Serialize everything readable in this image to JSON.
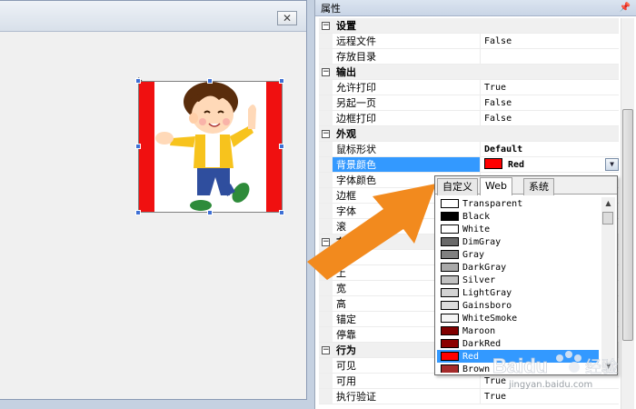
{
  "panel": {
    "title": "属性",
    "pin_icon": "pin-icon"
  },
  "designer": {
    "close_icon": "close-icon"
  },
  "properties": [
    {
      "type": "category",
      "name": "设置",
      "expander": "⊟"
    },
    {
      "type": "prop",
      "name": "远程文件",
      "value": "False"
    },
    {
      "type": "prop",
      "name": "存放目录",
      "value": ""
    },
    {
      "type": "category",
      "name": "输出",
      "expander": "⊟"
    },
    {
      "type": "prop",
      "name": "允许打印",
      "value": "True"
    },
    {
      "type": "prop",
      "name": "另起一页",
      "value": "False"
    },
    {
      "type": "prop",
      "name": "边框打印",
      "value": "False"
    },
    {
      "type": "category",
      "name": "外观",
      "expander": "⊟"
    },
    {
      "type": "prop",
      "name": "鼠标形状",
      "value": "Default"
    },
    {
      "type": "prop",
      "name": "背景颜色",
      "value": "Red"
    },
    {
      "type": "prop",
      "name": "字体颜色",
      "value": ""
    },
    {
      "type": "prop",
      "name": "边框",
      "value": ""
    },
    {
      "type": "prop",
      "name": "字体",
      "value": ""
    },
    {
      "type": "prop",
      "name": "滚",
      "value": ""
    },
    {
      "type": "category",
      "name": "布局",
      "expander": "⊟"
    },
    {
      "type": "prop",
      "name": "左",
      "value": ""
    },
    {
      "type": "prop",
      "name": "上",
      "value": ""
    },
    {
      "type": "prop",
      "name": "宽",
      "value": ""
    },
    {
      "type": "prop",
      "name": "高",
      "value": ""
    },
    {
      "type": "prop",
      "name": "锚定",
      "value": ""
    },
    {
      "type": "prop",
      "name": "停靠",
      "value": ""
    },
    {
      "type": "category",
      "name": "行为",
      "expander": "⊟"
    },
    {
      "type": "prop",
      "name": "可见",
      "value": ""
    },
    {
      "type": "prop",
      "name": "可用",
      "value": "True"
    },
    {
      "type": "prop",
      "name": "执行验证",
      "value": "True"
    }
  ],
  "dropdown": {
    "tabs": [
      "自定义",
      "Web",
      "系统"
    ],
    "active_tab": "Web",
    "selected": "Red",
    "colors": [
      {
        "name": "Transparent",
        "hex": "#ffffff"
      },
      {
        "name": "Black",
        "hex": "#000000"
      },
      {
        "name": "White",
        "hex": "#ffffff"
      },
      {
        "name": "DimGray",
        "hex": "#696969"
      },
      {
        "name": "Gray",
        "hex": "#808080"
      },
      {
        "name": "DarkGray",
        "hex": "#a9a9a9"
      },
      {
        "name": "Silver",
        "hex": "#c0c0c0"
      },
      {
        "name": "LightGray",
        "hex": "#d3d3d3"
      },
      {
        "name": "Gainsboro",
        "hex": "#dcdcdc"
      },
      {
        "name": "WhiteSmoke",
        "hex": "#f5f5f5"
      },
      {
        "name": "Maroon",
        "hex": "#800000"
      },
      {
        "name": "DarkRed",
        "hex": "#8b0000"
      },
      {
        "name": "Red",
        "hex": "#ff0000"
      },
      {
        "name": "Brown",
        "hex": "#a52a2a"
      }
    ]
  },
  "watermark": {
    "brand": "Baidu 经验",
    "site": "jingyan.baidu.com"
  },
  "colors": {
    "accent": "#3399ff",
    "arrow": "#f28a1e",
    "bar": "#f01010"
  }
}
